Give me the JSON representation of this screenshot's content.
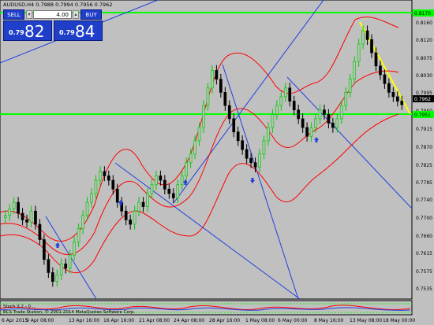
{
  "header": {
    "symbol_info": "AUDUSD,H4  0.7988 0.7994 0.7956 0.7962"
  },
  "trade_panel": {
    "sell_label": "SELL",
    "buy_label": "BUY",
    "lot_value": "4.00",
    "sell_price_small": "0.79",
    "sell_price_big": "82",
    "buy_price_small": "0.79",
    "buy_price_big": "84"
  },
  "price_axis": {
    "ticks": [
      "0.8160",
      "0.8120",
      "0.8075",
      "0.8030",
      "0.7995",
      "0.7950",
      "0.7915",
      "0.7870",
      "0.7825",
      "0.7785",
      "0.7740",
      "0.7700",
      "0.7660",
      "0.7615",
      "0.7575",
      "0.7535"
    ],
    "current_price": "0.7962",
    "level_top": "0.8170",
    "level_mid": "0.7951"
  },
  "time_axis": {
    "ticks": [
      "6 Apr 2015",
      "9 Apr 08:00",
      "13 Apr 16:00",
      "16 Apr 16:00",
      "21 Apr 08:00",
      "24 Apr 08:00",
      "28 Apr 16:00",
      "1 May 08:00",
      "6 May 00:00",
      "8 May 16:00",
      "13 May 08:00",
      "18 May 00:00"
    ]
  },
  "indicator": {
    "label": "Stoch 3.2 - 0 ..."
  },
  "copyright": "BCS Trade Station, © 2001-2014 MetaQuotes Software Corp.",
  "colors": {
    "background": "#c0c0c0",
    "bull": "#00cc00",
    "bear": "#000000",
    "bollinger": "#ff0000",
    "trendline": "#2040e0",
    "level": "#00ff00",
    "yellow_line": "#ffff00"
  },
  "chart_data": {
    "type": "candlestick",
    "ylim": [
      0.752,
      0.82
    ],
    "closes": [
      0.771,
      0.7725,
      0.774,
      0.7715,
      0.77,
      0.7695,
      0.772,
      0.769,
      0.7655,
      0.761,
      0.758,
      0.756,
      0.7575,
      0.76,
      0.759,
      0.762,
      0.765,
      0.768,
      0.771,
      0.774,
      0.776,
      0.779,
      0.781,
      0.78,
      0.779,
      0.777,
      0.774,
      0.772,
      0.77,
      0.769,
      0.772,
      0.774,
      0.773,
      0.776,
      0.778,
      0.78,
      0.779,
      0.777,
      0.776,
      0.775,
      0.778,
      0.78,
      0.783,
      0.785,
      0.788,
      0.791,
      0.796,
      0.8,
      0.804,
      0.802,
      0.799,
      0.796,
      0.793,
      0.79,
      0.788,
      0.786,
      0.784,
      0.783,
      0.782,
      0.785,
      0.788,
      0.791,
      0.794,
      0.796,
      0.798,
      0.8,
      0.797,
      0.795,
      0.793,
      0.791,
      0.789,
      0.791,
      0.793,
      0.795,
      0.794,
      0.792,
      0.791,
      0.793,
      0.796,
      0.799,
      0.802,
      0.806,
      0.81,
      0.813,
      0.811,
      0.808,
      0.805,
      0.803,
      0.801,
      0.799,
      0.798,
      0.797,
      0.7962
    ]
  }
}
